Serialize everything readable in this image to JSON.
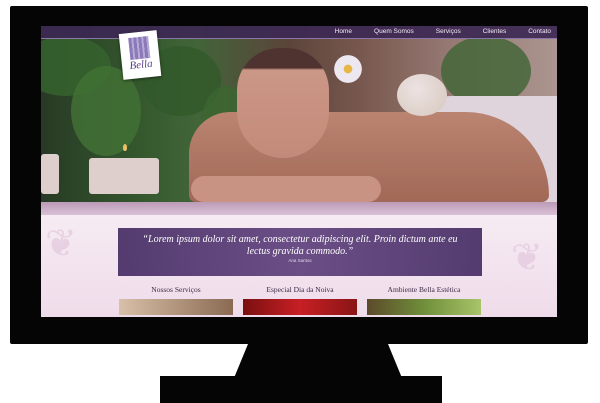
{
  "nav": {
    "items": [
      "Home",
      "Quem Somos",
      "Serviços",
      "Clientes",
      "Contato"
    ]
  },
  "logo": {
    "text": "Bella"
  },
  "quote": {
    "text": "“Lorem ipsum dolor sit amet, consectetur adipiscing elit. Proin dictum ante eu lectus gravida commodo.”",
    "author": "Ana Santos"
  },
  "sections": [
    {
      "title": "Nossos Serviços"
    },
    {
      "title": "Especial Dia da Noiva"
    },
    {
      "title": "Ambiente Bella Estética"
    }
  ],
  "colors": {
    "nav_bg": "#3d2854",
    "quote_bg": "#5a3f82",
    "content_bg": "#f4e6f0",
    "monitor": "#050505"
  }
}
